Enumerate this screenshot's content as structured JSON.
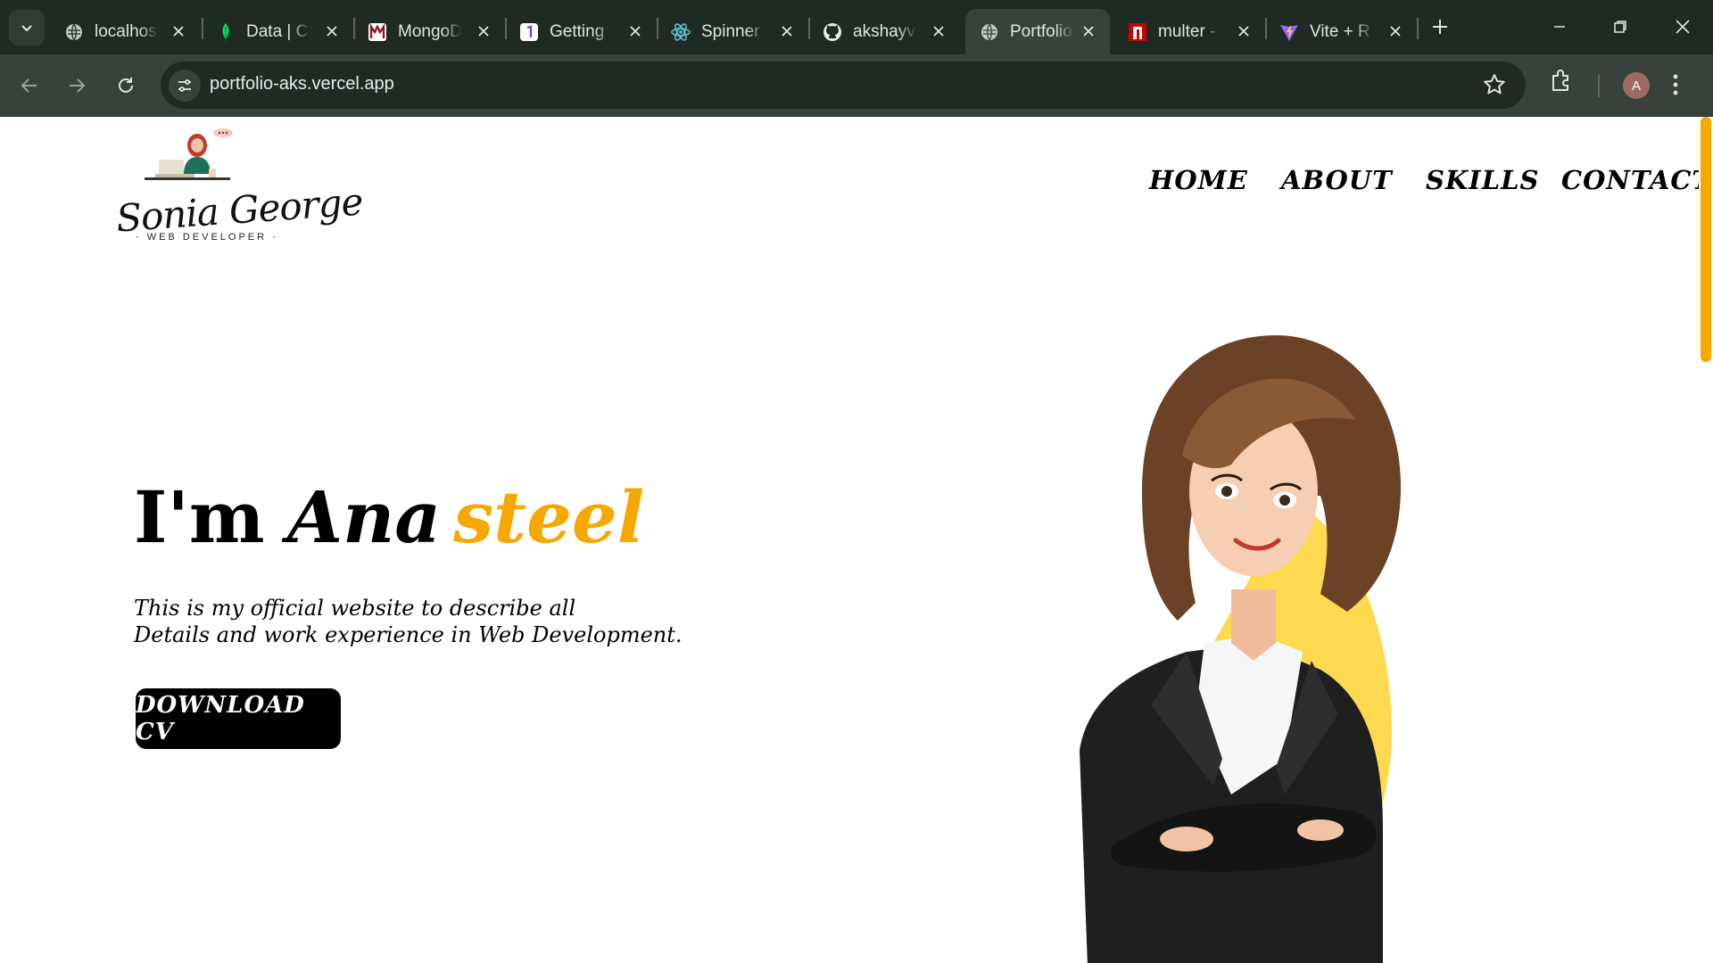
{
  "browser": {
    "tabs": [
      {
        "title": "localhost",
        "icon": "globe-icon"
      },
      {
        "title": "Data | C",
        "icon": "mongodb-leaf-icon"
      },
      {
        "title": "MongoDB",
        "icon": "m-logo-icon"
      },
      {
        "title": "Getting",
        "icon": "doc-icon"
      },
      {
        "title": "Spinner",
        "icon": "react-icon"
      },
      {
        "title": "akshayv",
        "icon": "github-icon"
      },
      {
        "title": "Portfolio",
        "icon": "globe-icon",
        "active": true
      },
      {
        "title": "multer -",
        "icon": "npm-icon"
      },
      {
        "title": "Vite + R",
        "icon": "vite-icon"
      }
    ],
    "url": "portfolio-aks.vercel.app",
    "profile_initial": "A"
  },
  "site": {
    "logo": {
      "signature": "Sonia George",
      "role": "· WEB DEVELOPER ·"
    },
    "nav": [
      "HOME",
      "ABOUT",
      "SKILLS",
      "CONTACT"
    ],
    "hero": {
      "greeting": "I'm",
      "name_first": "Ana",
      "name_second": "steel",
      "desc_line1": "This is my official website to describe all",
      "desc_line2": "Details and work experience in Web Development.",
      "cta": "DOWNLOAD CV"
    }
  },
  "colors": {
    "accent": "#f6a800",
    "blob": "#fdd94f",
    "chrome": "#1f2a22",
    "toolbar": "#36423a"
  }
}
